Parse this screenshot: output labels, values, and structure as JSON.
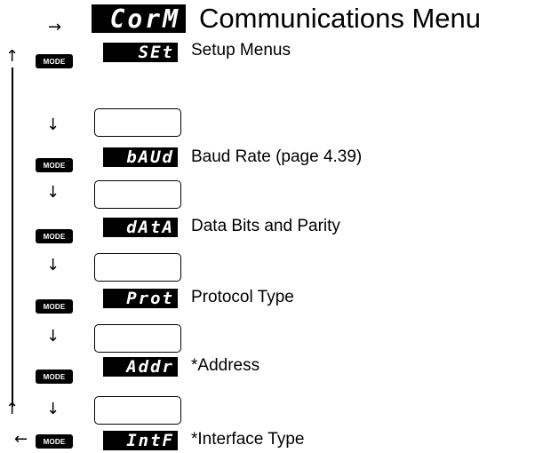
{
  "header": {
    "arrow": "→",
    "display": "CorM",
    "title": "Communications Menu"
  },
  "mode_label": "MODE",
  "rows": [
    {
      "display": "SEt",
      "label": "Setup Menus"
    },
    {
      "display": "bAUd",
      "label": "Baud Rate (page 4.39)"
    },
    {
      "display": "dAtA",
      "label": "Data Bits and Parity"
    },
    {
      "display": "Prot",
      "label": "Protocol Type"
    },
    {
      "display": "Addr",
      "label": "*Address"
    },
    {
      "display": "IntF",
      "label": "*Interface Type"
    }
  ],
  "arrows": {
    "up": "↑",
    "down": "↓",
    "left": "←"
  }
}
